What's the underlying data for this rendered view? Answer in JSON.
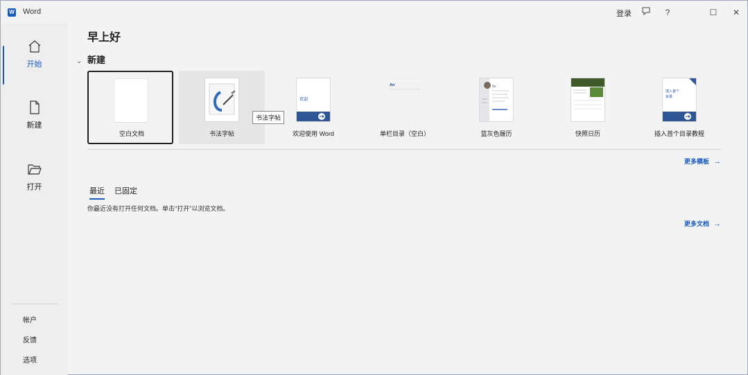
{
  "app": {
    "title": "Word",
    "icon_letter": "W"
  },
  "titlebar": {
    "signin_label": "登录",
    "icons": [
      "feedback-icon",
      "help-icon",
      "maximize-icon",
      "close-icon"
    ],
    "help_label": "?",
    "maximize_label": "☐",
    "close_label": "✕"
  },
  "sidebar": {
    "items": [
      {
        "label": "开始",
        "icon": "home-icon",
        "active": true
      },
      {
        "label": "新建",
        "icon": "new-document-icon"
      },
      {
        "label": "打开",
        "icon": "folder-open-icon"
      }
    ],
    "bottom": [
      {
        "label": "帐户"
      },
      {
        "label": "反馈"
      },
      {
        "label": "选项"
      }
    ]
  },
  "main": {
    "greeting": "早上好",
    "new_section": {
      "heading": "新建",
      "templates": [
        {
          "label": "空白文档"
        },
        {
          "label": "书法字帖"
        },
        {
          "label": "欢迎使用 Word"
        },
        {
          "label": "单栏目录（空白）"
        },
        {
          "label": "蓝灰色履历"
        },
        {
          "label": "快照日历"
        },
        {
          "label": "插入首个目录教程"
        }
      ],
      "tooltip": "书法字帖",
      "more_templates": "更多模板"
    },
    "recent": {
      "tabs": [
        "最近",
        "已固定"
      ],
      "empty_message": "你最近没有打开任何文档。单击\"打开\"以浏览文档。",
      "more_documents": "更多文档"
    }
  },
  "colors": {
    "accent": "#185abd",
    "background": "#f3f3f3",
    "sidebar": "#eeeeee"
  }
}
